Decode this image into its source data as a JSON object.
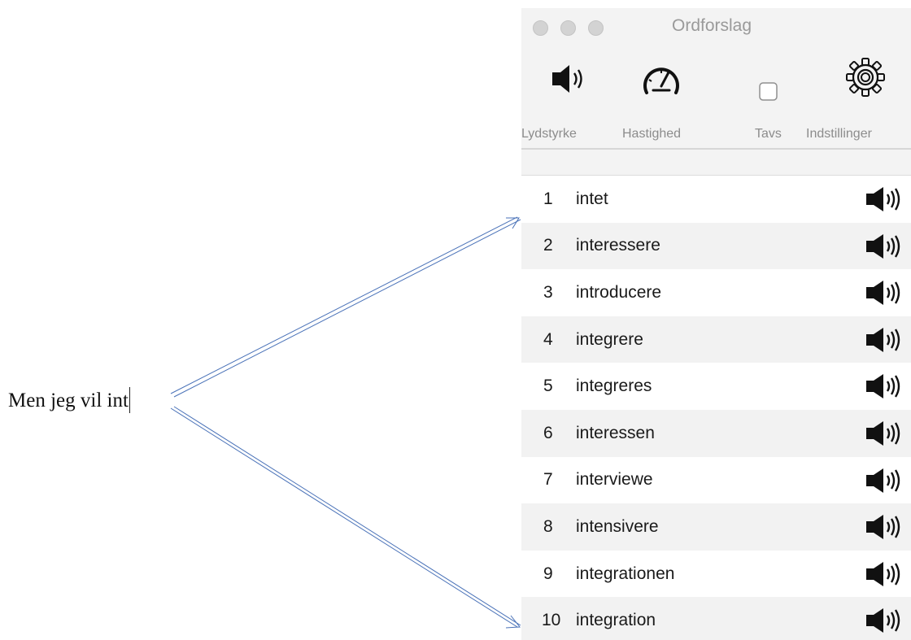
{
  "document": {
    "typed_text": "Men jeg vil int"
  },
  "window": {
    "title": "Ordforslag",
    "toolbar": [
      {
        "label": "Lydstyrke",
        "icon": "speaker-icon"
      },
      {
        "label": "Hastighed",
        "icon": "speedometer-icon"
      },
      {
        "label": "Tavs",
        "icon": "checkbox"
      },
      {
        "label": "Indstillinger",
        "icon": "gear-icon"
      }
    ]
  },
  "suggestions": [
    {
      "n": "1",
      "word": "intet"
    },
    {
      "n": "2",
      "word": "interessere"
    },
    {
      "n": "3",
      "word": "introducere"
    },
    {
      "n": "4",
      "word": "integrere"
    },
    {
      "n": "5",
      "word": "integreres"
    },
    {
      "n": "6",
      "word": "interessen"
    },
    {
      "n": "7",
      "word": "interviewe"
    },
    {
      "n": "8",
      "word": "intensivere"
    },
    {
      "n": "9",
      "word": "integrationen"
    },
    {
      "n": "10",
      "word": "integration"
    }
  ]
}
